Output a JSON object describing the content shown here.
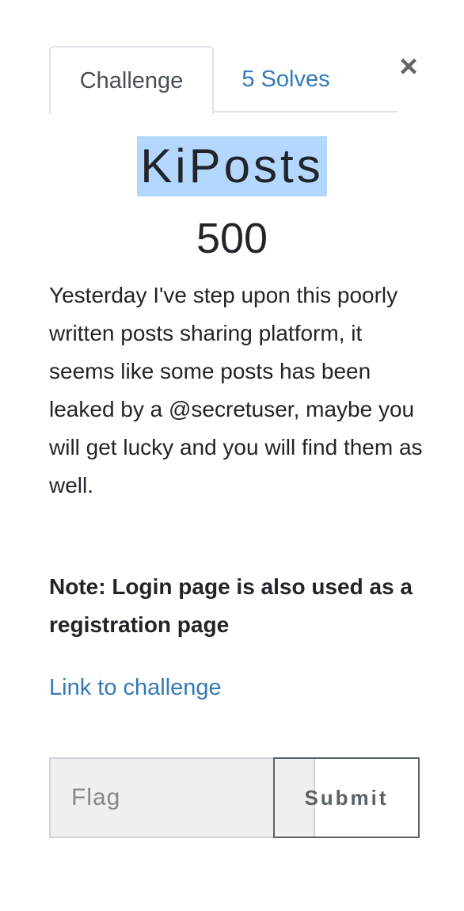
{
  "tabs": {
    "challenge_label": "Challenge",
    "solves_label": "5 Solves"
  },
  "close_symbol": "×",
  "challenge": {
    "name": "KiPosts",
    "value": "500",
    "description": "Yesterday I've step upon this poorly written posts sharing platform, it seems like some posts has been leaked by a @secretuser, maybe you will get lucky and you will find them as well.",
    "note": "Note: Login page is also used as a registration page",
    "link_text": "Link to challenge"
  },
  "form": {
    "flag_placeholder": "Flag",
    "flag_value": "",
    "submit_label": "Submit"
  }
}
